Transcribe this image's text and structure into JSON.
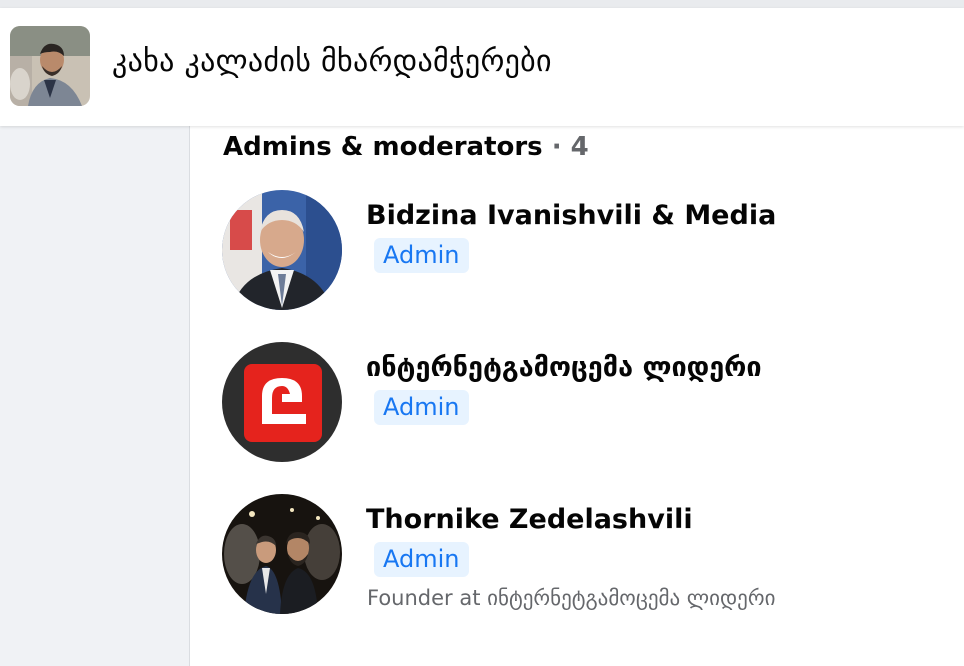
{
  "group": {
    "title": "კახა კალაძის მხარდამჭერები"
  },
  "section": {
    "heading": "Admins & moderators",
    "separator": "·",
    "count": "4"
  },
  "members": [
    {
      "name": "Bidzina Ivanishvili & Media",
      "role": "Admin",
      "subtitle": ""
    },
    {
      "name": "ინტერნეტგამოცემა ლიდერი",
      "role": "Admin",
      "subtitle": ""
    },
    {
      "name": "Thornike Zedelashvili",
      "role": "Admin",
      "subtitle": "Founder at ინტერნეტგამოცემა ლიდერი"
    }
  ],
  "colors": {
    "badge_bg": "#e7f3ff",
    "badge_text": "#1877f2",
    "leader_logo_red": "#e5231d"
  }
}
